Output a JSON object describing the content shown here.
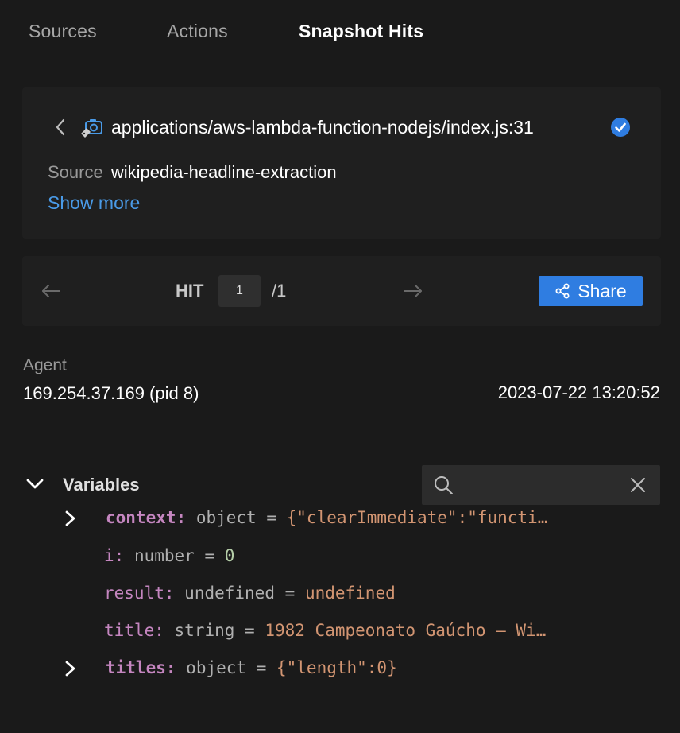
{
  "tabs": [
    {
      "label": "Sources",
      "active": false
    },
    {
      "label": "Actions",
      "active": false
    },
    {
      "label": "Snapshot Hits",
      "active": true
    }
  ],
  "source_card": {
    "file_path": "applications/aws-lambda-function-nodejs/index.js:31",
    "source_label": "Source",
    "source_value": "wikipedia-headline-extraction",
    "show_more": "Show more"
  },
  "hit_nav": {
    "hit_label": "HIT",
    "current": "1",
    "total": "/1",
    "share_label": "Share"
  },
  "agent": {
    "label": "Agent",
    "value": "169.254.37.169 (pid 8)",
    "timestamp": "2023-07-22 13:20:52"
  },
  "variables": {
    "title": "Variables",
    "search_placeholder": "",
    "items": [
      {
        "name": "context:",
        "type": "object",
        "eq": "=",
        "value": "{\"clearImmediate\":\"functi…",
        "expandable": true
      },
      {
        "name": "i:",
        "type": "number",
        "eq": "=",
        "value": "0",
        "expandable": false
      },
      {
        "name": "result:",
        "type": "undefined",
        "eq": "=",
        "value": "undefined",
        "expandable": false
      },
      {
        "name": "title:",
        "type": "string",
        "eq": "=",
        "value": "1982 Campeonato Gaúcho – Wi…",
        "expandable": false
      },
      {
        "name": "titles:",
        "type": "object",
        "eq": "=",
        "value": "{\"length\":0}",
        "expandable": true
      }
    ]
  },
  "colors": {
    "background": "#1a1a1a",
    "card": "#1f1f1f",
    "accent": "#2f7de1",
    "link": "#4a9be8",
    "var_name": "#c586c0",
    "var_value": "#d29572",
    "var_number": "#b5cea8"
  },
  "icons": [
    "chevron-left-icon",
    "camera-tag-icon",
    "verified-check-icon",
    "arrow-left-icon",
    "arrow-right-icon",
    "share-icon",
    "chevron-down-icon",
    "search-icon",
    "close-icon",
    "chevron-right-icon"
  ]
}
